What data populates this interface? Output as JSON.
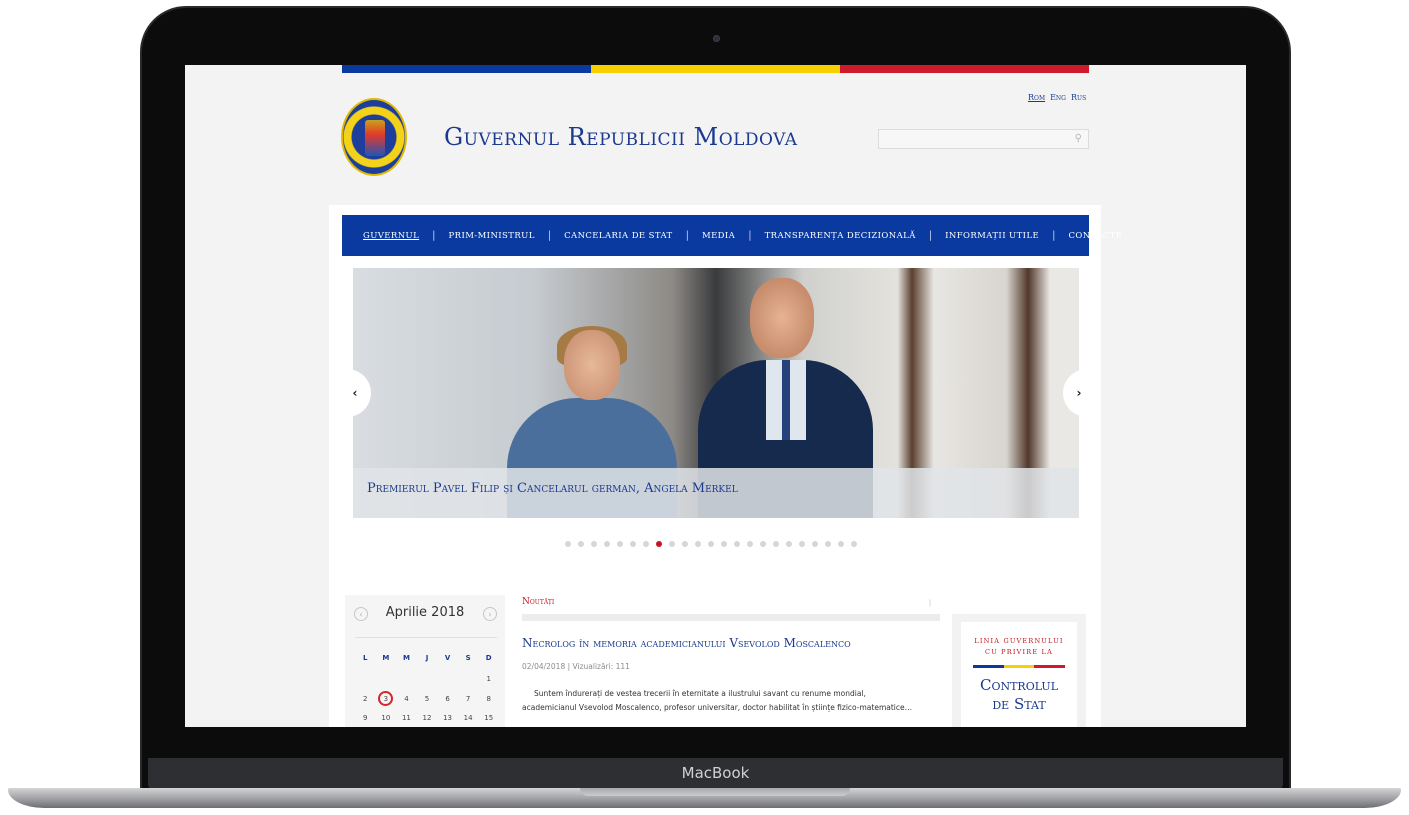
{
  "device": {
    "label": "MacBook"
  },
  "colors": {
    "nav_bg": "#0a3a9f",
    "brand_blue": "#1b3a8f",
    "accent_red": "#c4161c",
    "flag": [
      "#0a3a9f",
      "#f6d000",
      "#d0192a"
    ]
  },
  "header": {
    "title": "Guvernul Republicii Moldova",
    "languages": [
      {
        "label": "Rom",
        "active": true
      },
      {
        "label": "Eng"
      },
      {
        "label": "Rus"
      }
    ],
    "search": {
      "placeholder": ""
    }
  },
  "nav": {
    "items": [
      {
        "label": "Guvernul",
        "active": true
      },
      {
        "label": "Prim-ministrul"
      },
      {
        "label": "Cancelaria de Stat"
      },
      {
        "label": "Media"
      },
      {
        "label": "Transparența decizională"
      },
      {
        "label": "Informații utile"
      },
      {
        "label": "Contacte"
      }
    ]
  },
  "slider": {
    "caption": "Premierul Pavel Filip și Cancelarul german, Angela Merkel",
    "prev_icon": "chevron-left-icon",
    "next_icon": "chevron-right-icon",
    "dot_count": 23,
    "active_dot_index": 7
  },
  "calendar": {
    "month": "Aprilie 2018",
    "weekdays": [
      "L",
      "M",
      "M",
      "J",
      "V",
      "S",
      "D"
    ],
    "rows": [
      [
        "",
        "",
        "",
        "",
        "",
        "",
        "1"
      ],
      [
        "2",
        "3",
        "4",
        "5",
        "6",
        "7",
        "8"
      ],
      [
        "9",
        "10",
        "11",
        "12",
        "13",
        "14",
        "15"
      ]
    ],
    "today": "3"
  },
  "news": {
    "section_label": "Noutăți",
    "rss_icon": "rss-icon",
    "title": "Necrolog în memoria academicianului Vsevolod Moscalenco",
    "meta": "02/04/2018 | Vizualizări: 111",
    "excerpt": [
      "Suntem îndurerați de vestea trecerii în eternitate a ilustrului savant cu renume mondial,",
      "academicianul Vsevolod Moscalenco, profesor universitar, doctor habilitat în științe fizico-matematice…"
    ]
  },
  "sidebar_promo": {
    "line1": "Linia Guvernului",
    "line2": "cu privire la",
    "title1": "Controlul",
    "title2": "de Stat"
  }
}
